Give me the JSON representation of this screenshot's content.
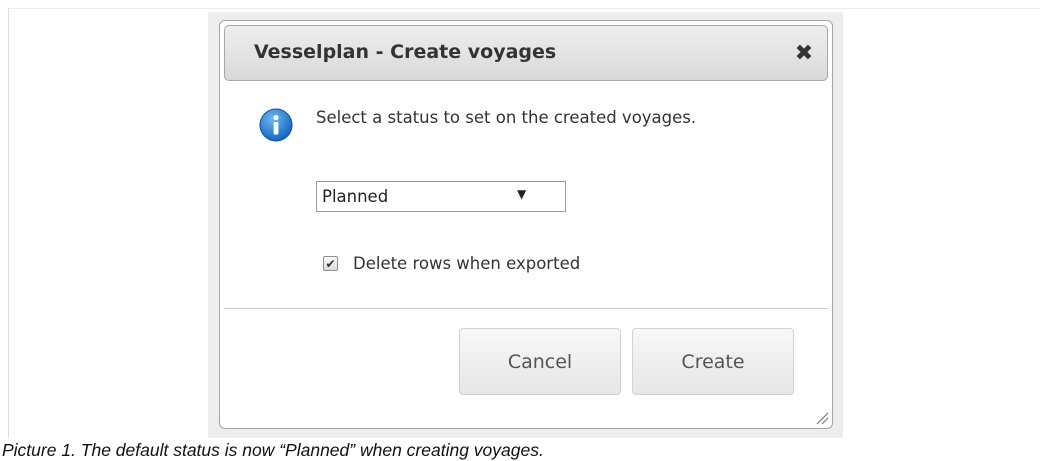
{
  "dialog": {
    "title": "Vesselplan - Create voyages",
    "close_icon": "close-icon",
    "info_icon": "info-icon",
    "message": "Select a status to set on the created voyages.",
    "status_select": {
      "selected": "Planned",
      "arrow": "▼"
    },
    "delete_rows": {
      "checked": true,
      "label": "Delete rows when exported"
    },
    "buttons": {
      "cancel": "Cancel",
      "create": "Create"
    }
  },
  "caption": "Picture 1. The default status is now “Planned” when creating voyages.",
  "colors": {
    "info_blue": "#1e7ad6",
    "titlebar_top": "#eeeeee",
    "titlebar_bottom": "#d9d9d9"
  }
}
